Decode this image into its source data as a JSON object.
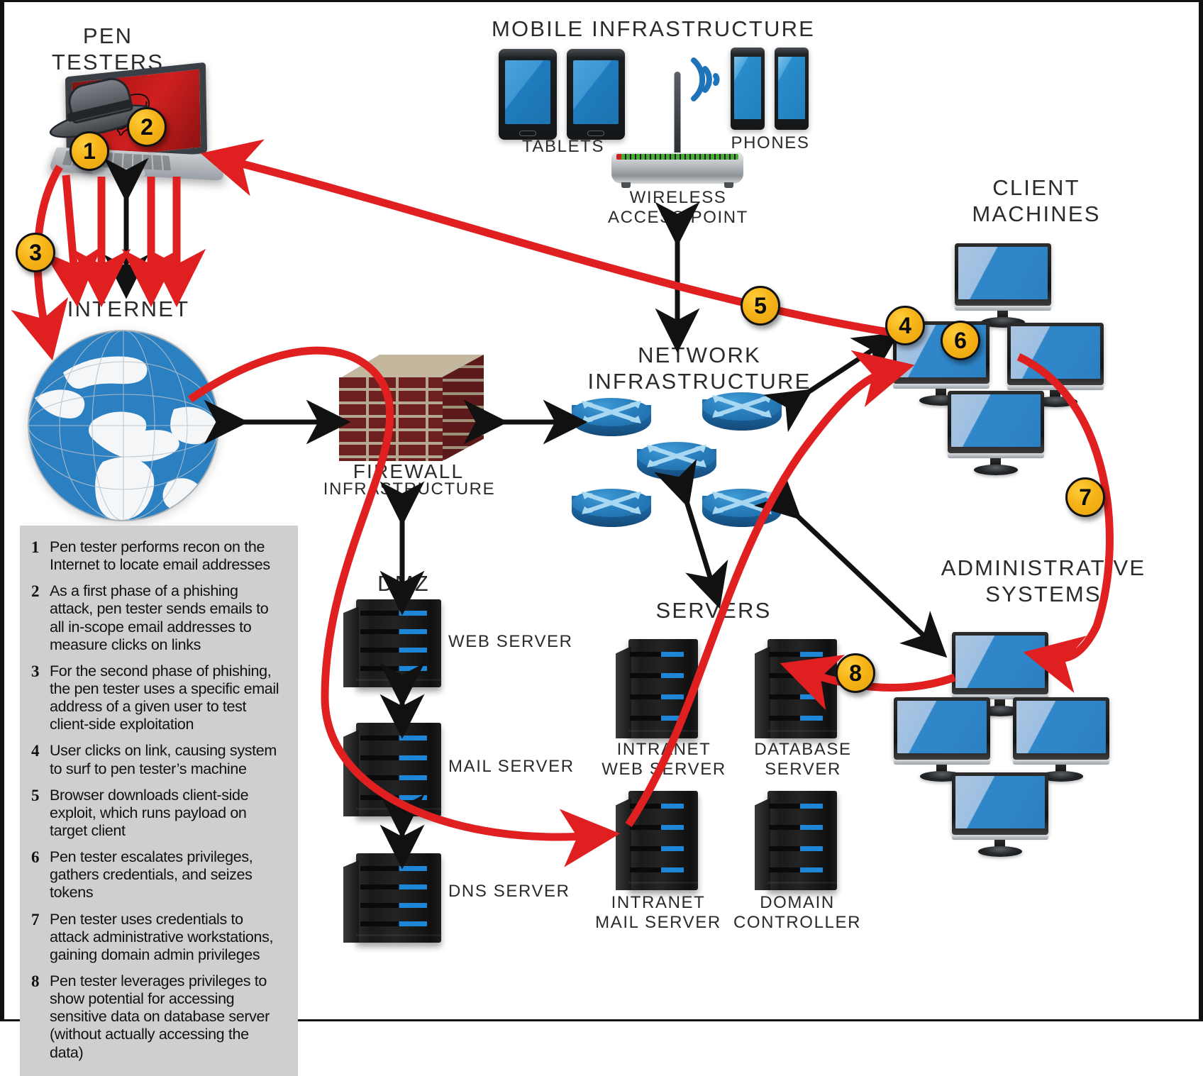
{
  "sections": {
    "pen_testers": "PEN TESTERS",
    "mobile_infrastructure": "MOBILE INFRASTRUCTURE",
    "tablets": "TABLETS",
    "phones": "PHONES",
    "wireless_access_point": "WIRELESS\nACCESS POINT",
    "client_machines": "CLIENT\nMACHINES",
    "internet": "INTERNET",
    "network_infrastructure": "NETWORK\nINFRASTRUCTURE",
    "firewall": "FIREWALL",
    "firewall_sub": "INFRASTRUCTURE",
    "dmz": "DMZ",
    "servers": "SERVERS",
    "administrative_systems": "ADMINISTRATIVE\nSYSTEMS"
  },
  "devices": {
    "web_server": "WEB SERVER",
    "mail_server": "MAIL SERVER",
    "dns_server": "DNS SERVER",
    "intranet_web_server": "INTRANET\nWEB SERVER",
    "database_server": "DATABASE\nSERVER",
    "intranet_mail_server": "INTRANET\nMAIL SERVER",
    "domain_controller": "DOMAIN\nCONTROLLER"
  },
  "badges": [
    {
      "id": "1",
      "label": "1"
    },
    {
      "id": "2",
      "label": "2"
    },
    {
      "id": "3",
      "label": "3"
    },
    {
      "id": "4",
      "label": "4"
    },
    {
      "id": "5",
      "label": "5"
    },
    {
      "id": "6",
      "label": "6"
    },
    {
      "id": "7",
      "label": "7"
    },
    {
      "id": "8",
      "label": "8"
    }
  ],
  "legend": [
    {
      "num": "1",
      "text": "Pen tester performs recon on the Internet to locate email addresses"
    },
    {
      "num": "2",
      "text": "As a first phase of a phishing attack, pen tester sends emails to all in-scope email addresses to measure clicks on links"
    },
    {
      "num": "3",
      "text": "For the second phase of phishing, the pen tester uses a specific email address of a given user to test client-side exploitation"
    },
    {
      "num": "4",
      "text": "User clicks on link, causing system to surf to pen tester’s machine"
    },
    {
      "num": "5",
      "text": "Browser downloads client-side exploit, which runs payload on target client"
    },
    {
      "num": "6",
      "text": "Pen tester escalates privileges, gathers credentials, and seizes tokens"
    },
    {
      "num": "7",
      "text": "Pen tester uses credentials to attack administrative workstations, gaining domain admin privileges"
    },
    {
      "num": "8",
      "text": "Pen tester leverages privileges to show potential for accessing sensitive data on database server (without actually accessing the data)"
    }
  ],
  "colors": {
    "attack_path": "#E02020",
    "flow_arrow": "#111111",
    "badge_fill": "#F6B317",
    "legend_bg": "#CFCFCF",
    "device_blue": "#2F86C8",
    "router_blue": "#1B5F98",
    "brick_red": "#6E2020"
  }
}
